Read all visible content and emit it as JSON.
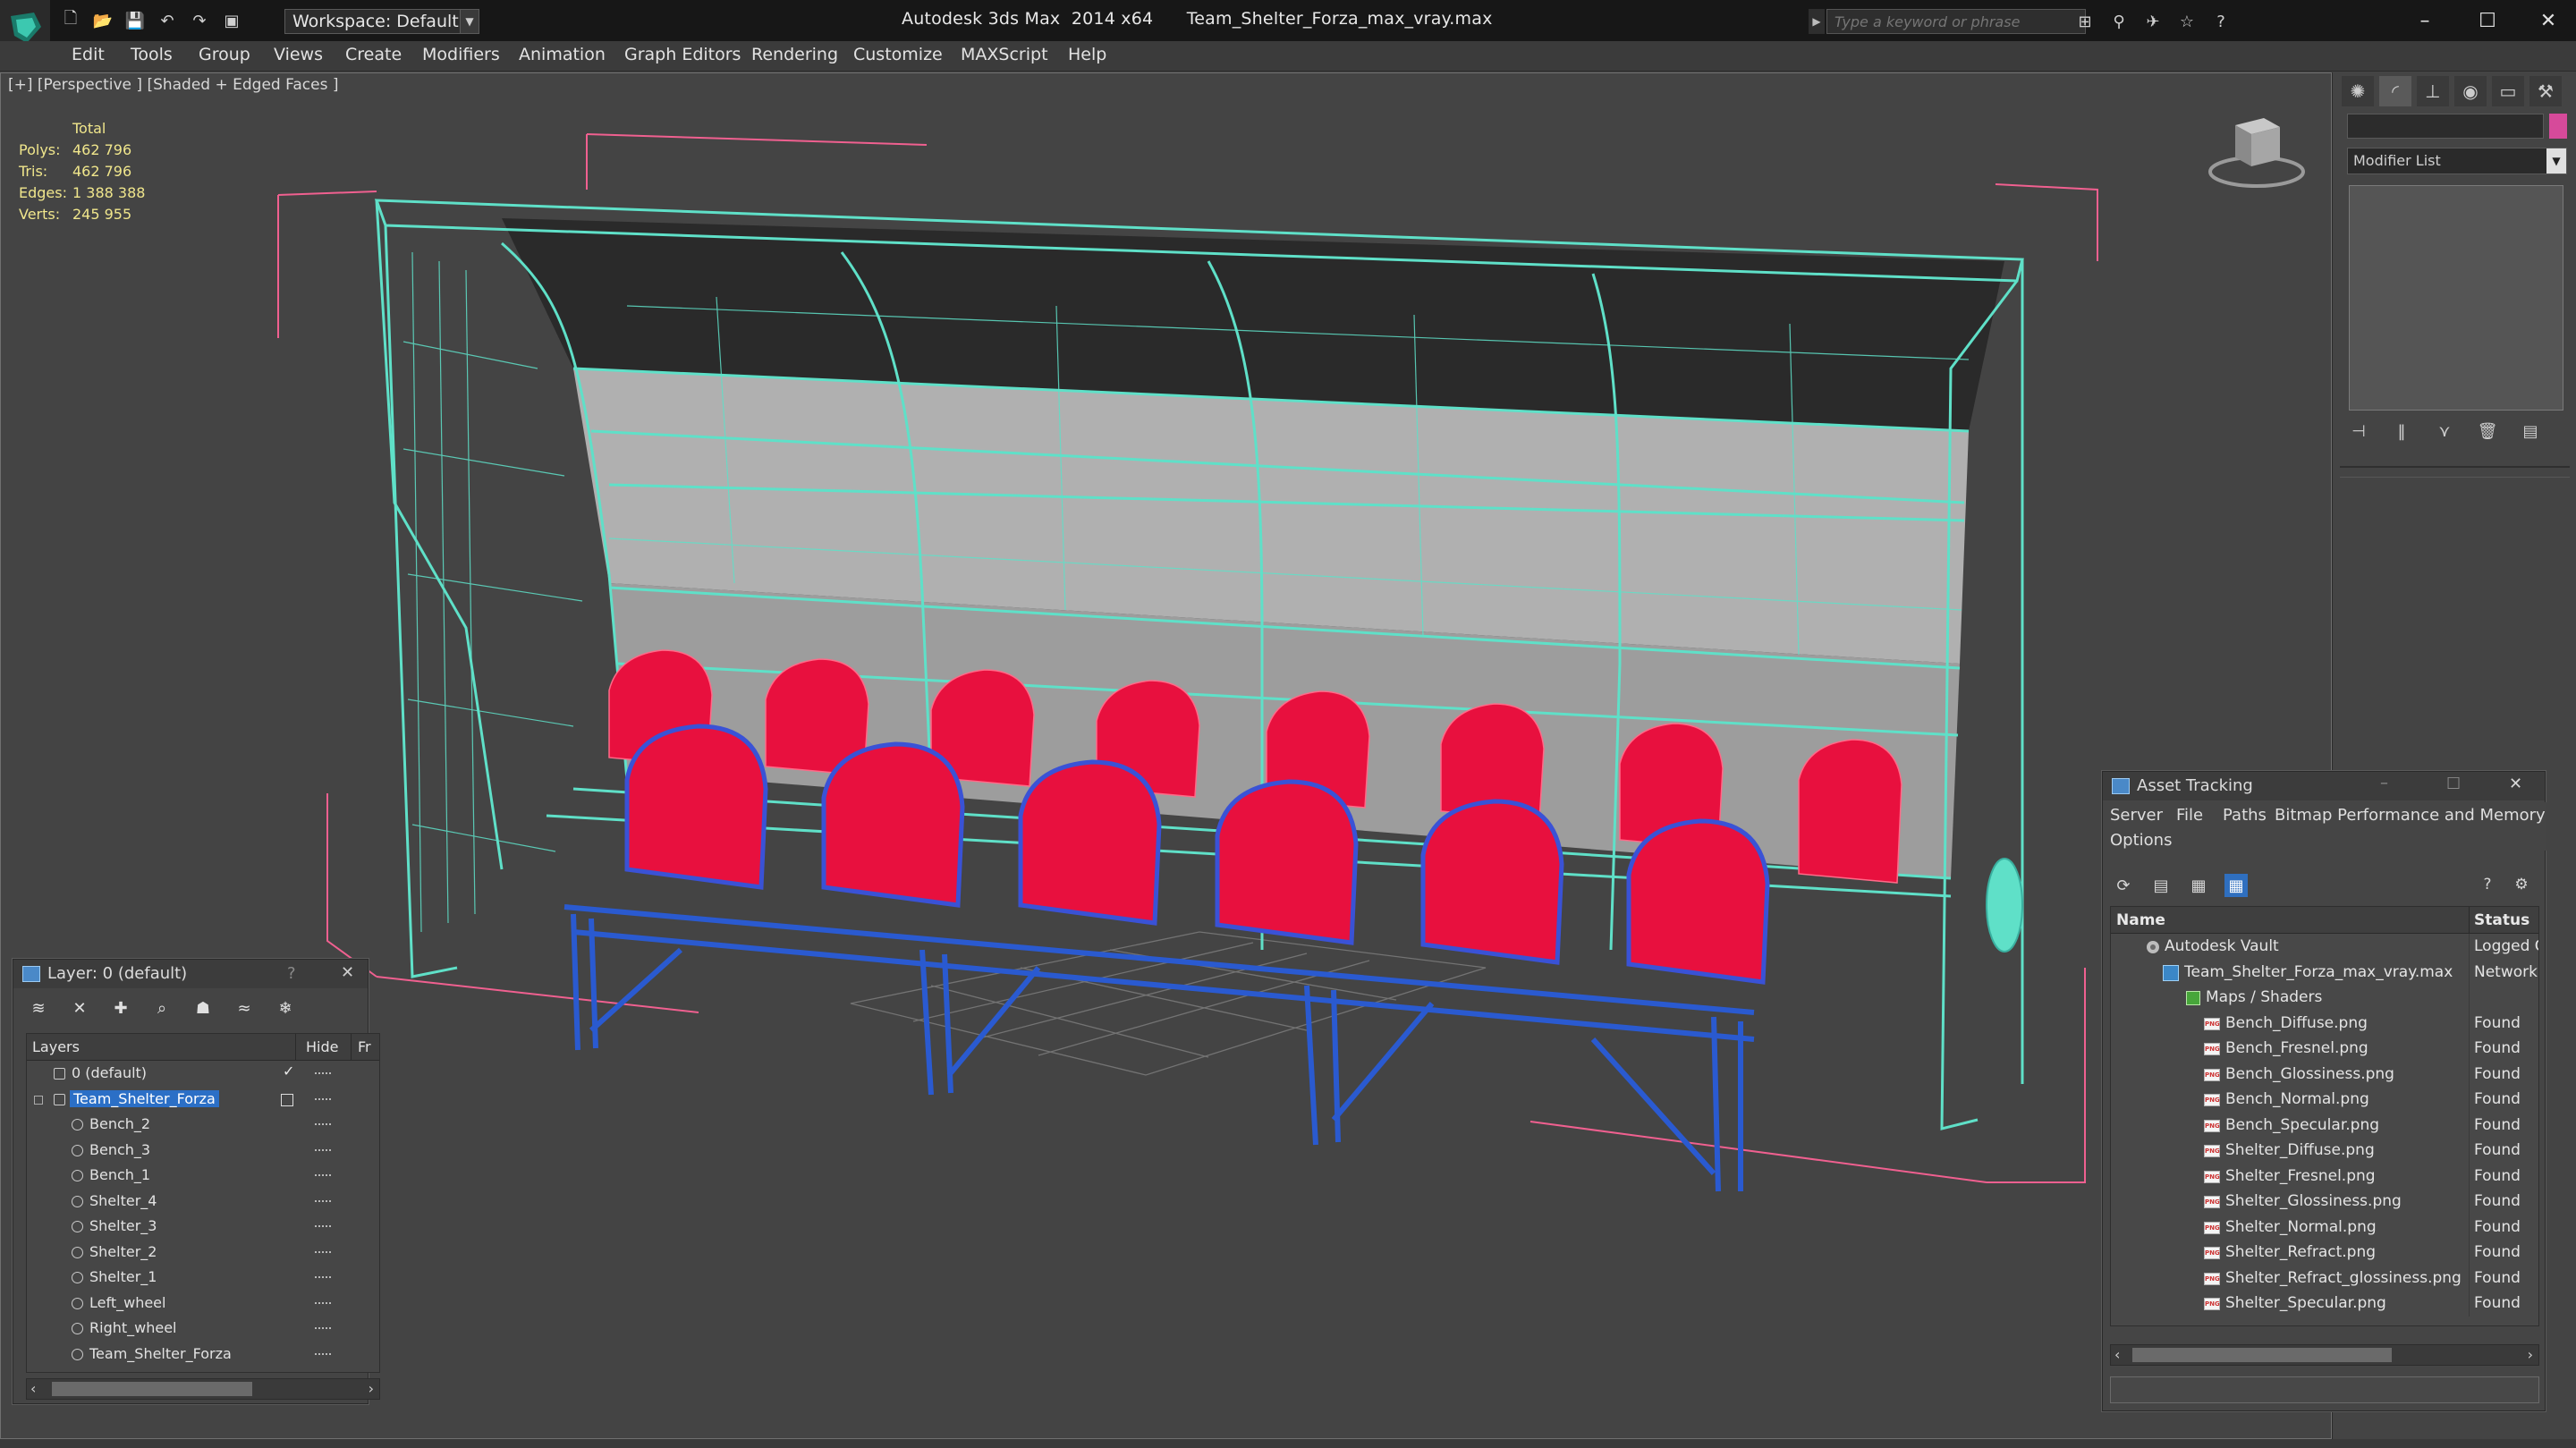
{
  "title_bar": {
    "app_title": "Autodesk 3ds Max  2014 x64      Team_Shelter_Forza_max_vray.max",
    "workspace": "Workspace: Default",
    "search_placeholder": "Type a keyword or phrase",
    "win_min": "–",
    "win_max": "☐",
    "win_close": "✕"
  },
  "menu": [
    "Edit",
    "Tools",
    "Group",
    "Views",
    "Create",
    "Modifiers",
    "Animation",
    "Graph Editors",
    "Rendering",
    "Customize",
    "MAXScript",
    "Help"
  ],
  "viewport": {
    "label": "[+] [Perspective ] [Shaded + Edged Faces ]",
    "stats": {
      "header": "Total",
      "rows": [
        {
          "k": "Polys:",
          "v": "462 796"
        },
        {
          "k": "Tris:",
          "v": "462 796"
        },
        {
          "k": "Edges:",
          "v": "1 388 388"
        },
        {
          "k": "Verts:",
          "v": "245 955"
        }
      ]
    },
    "colors": {
      "wire_cyan": "#5fe0c8",
      "seat_red": "#e8103e",
      "frame_blue": "#2a5ad0",
      "bbox_pink": "#f06090"
    }
  },
  "command_panel": {
    "modifier_list": "Modifier List",
    "object_color": "#d64a9a"
  },
  "layer_dialog": {
    "title": "Layer: 0 (default)",
    "help": "?",
    "close": "✕",
    "col_layers": "Layers",
    "col_hide": "Hide",
    "col_fr": "Fr",
    "rows": [
      {
        "name": "0 (default)",
        "level": 0,
        "check": "✓"
      },
      {
        "name": "Team_Shelter_Forza",
        "level": 0,
        "selected": true
      },
      {
        "name": "Bench_2",
        "level": 1
      },
      {
        "name": "Bench_3",
        "level": 1
      },
      {
        "name": "Bench_1",
        "level": 1
      },
      {
        "name": "Shelter_4",
        "level": 1
      },
      {
        "name": "Shelter_3",
        "level": 1
      },
      {
        "name": "Shelter_2",
        "level": 1
      },
      {
        "name": "Shelter_1",
        "level": 1
      },
      {
        "name": "Left_wheel",
        "level": 1
      },
      {
        "name": "Right_wheel",
        "level": 1
      },
      {
        "name": "Team_Shelter_Forza",
        "level": 1
      }
    ]
  },
  "asset_dialog": {
    "title": "Asset Tracking",
    "menu": [
      "Server",
      "File",
      "Paths",
      "Bitmap Performance and Memory",
      "Options"
    ],
    "col_name": "Name",
    "col_status": "Status",
    "rows": [
      {
        "name": "Autodesk Vault",
        "status": "Logged C",
        "type": "vault",
        "level": 0
      },
      {
        "name": "Team_Shelter_Forza_max_vray.max",
        "status": "Network",
        "type": "max",
        "level": 1
      },
      {
        "name": "Maps / Shaders",
        "status": "",
        "type": "maps",
        "level": 2
      },
      {
        "name": "Bench_Diffuse.png",
        "status": "Found",
        "type": "png",
        "level": 3
      },
      {
        "name": "Bench_Fresnel.png",
        "status": "Found",
        "type": "png",
        "level": 3
      },
      {
        "name": "Bench_Glossiness.png",
        "status": "Found",
        "type": "png",
        "level": 3
      },
      {
        "name": "Bench_Normal.png",
        "status": "Found",
        "type": "png",
        "level": 3
      },
      {
        "name": "Bench_Specular.png",
        "status": "Found",
        "type": "png",
        "level": 3
      },
      {
        "name": "Shelter_Diffuse.png",
        "status": "Found",
        "type": "png",
        "level": 3
      },
      {
        "name": "Shelter_Fresnel.png",
        "status": "Found",
        "type": "png",
        "level": 3
      },
      {
        "name": "Shelter_Glossiness.png",
        "status": "Found",
        "type": "png",
        "level": 3
      },
      {
        "name": "Shelter_Normal.png",
        "status": "Found",
        "type": "png",
        "level": 3
      },
      {
        "name": "Shelter_Refract.png",
        "status": "Found",
        "type": "png",
        "level": 3
      },
      {
        "name": "Shelter_Refract_glossiness.png",
        "status": "Found",
        "type": "png",
        "level": 3
      },
      {
        "name": "Shelter_Specular.png",
        "status": "Found",
        "type": "png",
        "level": 3
      }
    ]
  }
}
